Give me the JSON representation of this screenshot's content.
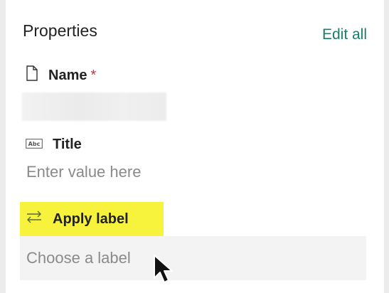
{
  "panel": {
    "title": "Properties",
    "edit_all_label": "Edit all"
  },
  "fields": {
    "name": {
      "icon": "document-icon",
      "label": "Name",
      "required_marker": "*"
    },
    "title": {
      "icon": "text-field-icon",
      "icon_text": "Abc",
      "label": "Title",
      "placeholder": "Enter value here"
    },
    "apply_label": {
      "icon": "swap-arrows-icon",
      "label": "Apply label",
      "placeholder": "Choose a label",
      "highlight_color": "#f7f33c"
    }
  },
  "colors": {
    "accent": "#1a7d6b",
    "required": "#c4314b"
  }
}
